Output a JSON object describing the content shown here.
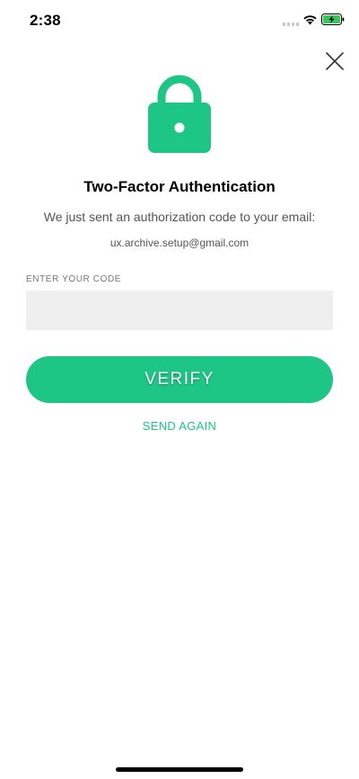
{
  "status_bar": {
    "time": "2:38",
    "icons": [
      "cellular-signal-icon",
      "wifi-icon",
      "battery-charging-icon"
    ],
    "battery_color": "#34c759"
  },
  "header": {
    "close_icon": "close-icon"
  },
  "lock_icon": {
    "name": "padlock-icon",
    "color": "#1ec685"
  },
  "title": "Two-Factor Authentication",
  "subtitle": "We just sent an authorization code to your email:",
  "email": "ux.archive.setup@gmail.com",
  "code_field": {
    "label": "ENTER YOUR CODE",
    "value": "",
    "placeholder": ""
  },
  "verify_button": {
    "label": "VERIFY"
  },
  "send_again_link": {
    "label": "SEND AGAIN"
  },
  "colors": {
    "accent": "#1ec685",
    "input_background": "#efefef"
  }
}
